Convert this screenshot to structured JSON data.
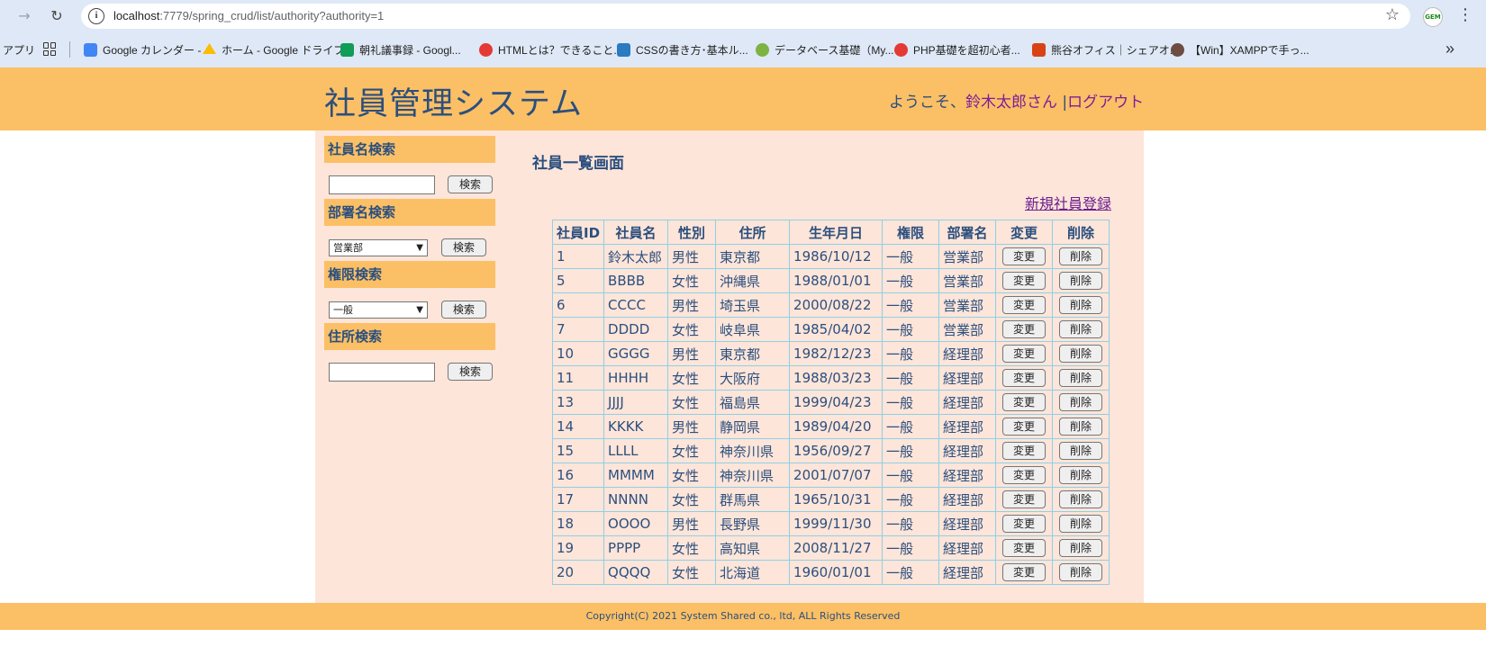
{
  "browser": {
    "url_host": "localhost",
    "url_rest": ":7779/spring_crud/list/authority?authority=1",
    "profile_label": "GEM",
    "bookmarks": [
      {
        "label": "アプリ",
        "color": ""
      },
      {
        "label": "Google カレンダー -",
        "color": "#4285f4"
      },
      {
        "label": "ホーム - Google ドライブ",
        "color": "#fbbc04"
      },
      {
        "label": "朝礼議事録 - Googl...",
        "color": "#0f9d58"
      },
      {
        "label": "HTMLとは？できること...",
        "color": "#e53935"
      },
      {
        "label": "CSSの書き方･基本ル...",
        "color": "#2a7bbf"
      },
      {
        "label": "データベース基礎（My...",
        "color": "#7cb342"
      },
      {
        "label": "PHP基礎を超初心者...",
        "color": "#e53935"
      },
      {
        "label": "熊谷オフィス｜シェアオ...",
        "color": "#d84315"
      },
      {
        "label": "【Win】XAMPPで手っ...",
        "color": "#6d4c41"
      }
    ]
  },
  "header": {
    "title": "社員管理システム",
    "welcome_prefix": "ようこそ、",
    "user_name": "鈴木太郎さん",
    "separator": " |",
    "logout": "ログアウト"
  },
  "sidebar": {
    "name_search": {
      "heading": "社員名検索",
      "value": "",
      "button": "検索"
    },
    "dept_search": {
      "heading": "部署名検索",
      "selected": "営業部",
      "button": "検索"
    },
    "auth_search": {
      "heading": "権限検索",
      "selected": "一般",
      "button": "検索"
    },
    "addr_search": {
      "heading": "住所検索",
      "value": "",
      "button": "検索"
    }
  },
  "main": {
    "title": "社員一覧画面",
    "new_link": "新規社員登録",
    "columns": [
      "社員ID",
      "社員名",
      "性別",
      "住所",
      "生年月日",
      "権限",
      "部署名",
      "変更",
      "削除"
    ],
    "edit_label": "変更",
    "delete_label": "削除",
    "rows": [
      {
        "id": "1",
        "name": "鈴木太郎",
        "gender": "男性",
        "address": "東京都",
        "birthday": "1986/10/12",
        "authority": "一般",
        "dept": "営業部"
      },
      {
        "id": "5",
        "name": "BBBB",
        "gender": "女性",
        "address": "沖縄県",
        "birthday": "1988/01/01",
        "authority": "一般",
        "dept": "営業部"
      },
      {
        "id": "6",
        "name": "CCCC",
        "gender": "男性",
        "address": "埼玉県",
        "birthday": "2000/08/22",
        "authority": "一般",
        "dept": "営業部"
      },
      {
        "id": "7",
        "name": "DDDD",
        "gender": "女性",
        "address": "岐阜県",
        "birthday": "1985/04/02",
        "authority": "一般",
        "dept": "営業部"
      },
      {
        "id": "10",
        "name": "GGGG",
        "gender": "男性",
        "address": "東京都",
        "birthday": "1982/12/23",
        "authority": "一般",
        "dept": "経理部"
      },
      {
        "id": "11",
        "name": "HHHH",
        "gender": "女性",
        "address": "大阪府",
        "birthday": "1988/03/23",
        "authority": "一般",
        "dept": "経理部"
      },
      {
        "id": "13",
        "name": "JJJJ",
        "gender": "女性",
        "address": "福島県",
        "birthday": "1999/04/23",
        "authority": "一般",
        "dept": "経理部"
      },
      {
        "id": "14",
        "name": "KKKK",
        "gender": "男性",
        "address": "静岡県",
        "birthday": "1989/04/20",
        "authority": "一般",
        "dept": "経理部"
      },
      {
        "id": "15",
        "name": "LLLL",
        "gender": "女性",
        "address": "神奈川県",
        "birthday": "1956/09/27",
        "authority": "一般",
        "dept": "経理部"
      },
      {
        "id": "16",
        "name": "MMMM",
        "gender": "女性",
        "address": "神奈川県",
        "birthday": "2001/07/07",
        "authority": "一般",
        "dept": "経理部"
      },
      {
        "id": "17",
        "name": "NNNN",
        "gender": "女性",
        "address": "群馬県",
        "birthday": "1965/10/31",
        "authority": "一般",
        "dept": "経理部"
      },
      {
        "id": "18",
        "name": "OOOO",
        "gender": "男性",
        "address": "長野県",
        "birthday": "1999/11/30",
        "authority": "一般",
        "dept": "経理部"
      },
      {
        "id": "19",
        "name": "PPPP",
        "gender": "女性",
        "address": "高知県",
        "birthday": "2008/11/27",
        "authority": "一般",
        "dept": "経理部"
      },
      {
        "id": "20",
        "name": "QQQQ",
        "gender": "女性",
        "address": "北海道",
        "birthday": "1960/01/01",
        "authority": "一般",
        "dept": "経理部"
      }
    ]
  },
  "footer": {
    "copyright": "Copyright(C) 2021 System Shared co., ltd, ALL Rights Reserved"
  }
}
